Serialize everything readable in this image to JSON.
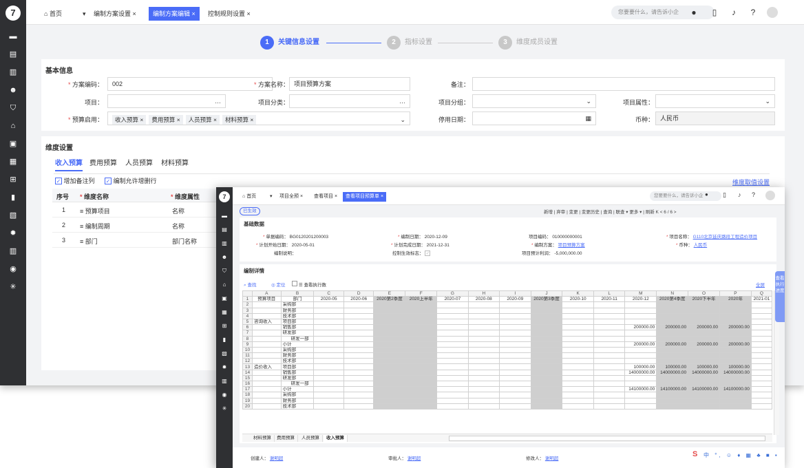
{
  "back": {
    "tabs": [
      "首页",
      "编制方案设置 ×",
      "编制方案编辑 ×",
      "控制规则设置 ×"
    ],
    "search_placeholder": "您要要什么，请告诉小企",
    "steps": [
      {
        "num": "1",
        "label": "关键信息设置"
      },
      {
        "num": "2",
        "label": "指标设置"
      },
      {
        "num": "3",
        "label": "维度成员设置"
      }
    ],
    "basic_title": "基本信息",
    "fields": {
      "code_label": "方案编码：",
      "code_value": "002",
      "name_label": "方案名称：",
      "name_value": "项目预算方案",
      "remark_label": "备注：",
      "project_label": "项目：",
      "project_dots": "…",
      "category_label": "项目分类：",
      "category_dots": "…",
      "group_label": "项目分组：",
      "attr_label": "项目属性：",
      "enable_label": "预算启用：",
      "enable_chips": [
        "收入预算 ×",
        "费用预算 ×",
        "人员预算 ×",
        "材料预算 ×"
      ],
      "stop_label": "停用日期：",
      "currency_label": "币种：",
      "currency_value": "人民币"
    },
    "dim_title": "维度设置",
    "dim_tabs": [
      "收入预算",
      "费用预算",
      "人员预算",
      "材料预算"
    ],
    "check1": "增加备注列",
    "check2": "编制允许增删行",
    "link_right": "维度取值设置",
    "table_headers": [
      "序号",
      "维度名称",
      "维度属性"
    ],
    "rows": [
      {
        "n": "1",
        "name": "≡ 预算项目",
        "attr": "名称"
      },
      {
        "n": "2",
        "name": "≡ 编制周期",
        "attr": "名称"
      },
      {
        "n": "3",
        "name": "≡ 部门",
        "attr": "部门名称"
      }
    ]
  },
  "front": {
    "tabs": [
      "首页",
      "项目全预 ×",
      "查看项目 ×",
      "查看项目预算单 ×"
    ],
    "search_placeholder": "您要要什么，请告诉小企",
    "status": "已生效",
    "toolbar": "新增 | 弃审 | 变更 | 变更历史 | 查询 | 联查 ▾  更多 ▾ | 刷新  K  <  6 / 6  >",
    "basic_title": "基础数据",
    "info": [
      {
        "label": "单据编码：",
        "value": "BG0120201200003"
      },
      {
        "label": "编制日期：",
        "value": "2020-12-09"
      },
      {
        "label": "项目编码：",
        "value": "010000000001"
      },
      {
        "label": "项目名称：",
        "value": "G110北京延庆路段工程造价项目"
      },
      {
        "label": "计划开始日期：",
        "value": "2020-05-01"
      },
      {
        "label": "计划完成日期：",
        "value": "2021-12-31"
      },
      {
        "label": "编制方案：",
        "value": "项目预算方案"
      },
      {
        "label": "币种：",
        "value": "人民币"
      },
      {
        "label": "编制说明：",
        "value": ""
      },
      {
        "label": "控制生效标志：",
        "value": "✓"
      },
      {
        "label": "项目预计利润：",
        "value": "-5,000,000.00"
      }
    ],
    "detail_title": "编制详情",
    "grid_tools": [
      "查找",
      "定位",
      "查看执行数"
    ],
    "grid_tools_right": "全屏",
    "col_letters": [
      "A",
      "B",
      "C",
      "D",
      "E",
      "F",
      "G",
      "H",
      "I",
      "J",
      "K",
      "L",
      "M",
      "N",
      "O",
      "P",
      "Q"
    ],
    "header_row": [
      "预算项目",
      "部门",
      "2020-05",
      "2020-06",
      "2020第2季度",
      "2020上半年",
      "2020-07",
      "2020-08",
      "2020-09",
      "2020第3季度",
      "2020-10",
      "2020-11",
      "2020-12",
      "2020第4季度",
      "2020下半年",
      "2020年",
      "2021-01"
    ],
    "group1": "咨询收入",
    "group2": "造价收入",
    "depts": [
      "采购部",
      "财务部",
      "技术部",
      "项目部",
      "销售部",
      "研发部",
      "研发一部",
      "小计"
    ],
    "g1_sales": [
      "200000.00",
      "200000.00",
      "200000.00",
      "200000.00"
    ],
    "g1_total": [
      "200000.00",
      "200000.00",
      "200000.00",
      "200000.00"
    ],
    "g2_proj": [
      "100000.00",
      "100000.00",
      "100000.00",
      "100000.00"
    ],
    "g2_sales": [
      "14000000.00",
      "14000000.00",
      "14000000.00",
      "14000000.00"
    ],
    "g2_total": [
      "14100000.00",
      "14100000.00",
      "14100000.00",
      "14100000.00"
    ],
    "sheet_tabs": [
      "材料预算",
      "费用预算",
      "人员预算",
      "收入预算"
    ],
    "footer": [
      {
        "label": "创建人：",
        "value": "谢明超"
      },
      {
        "label": "审批人：",
        "value": "谢明超"
      },
      {
        "label": "修改人：",
        "value": "谢明超"
      }
    ],
    "side_tab": "查看执行进度"
  }
}
